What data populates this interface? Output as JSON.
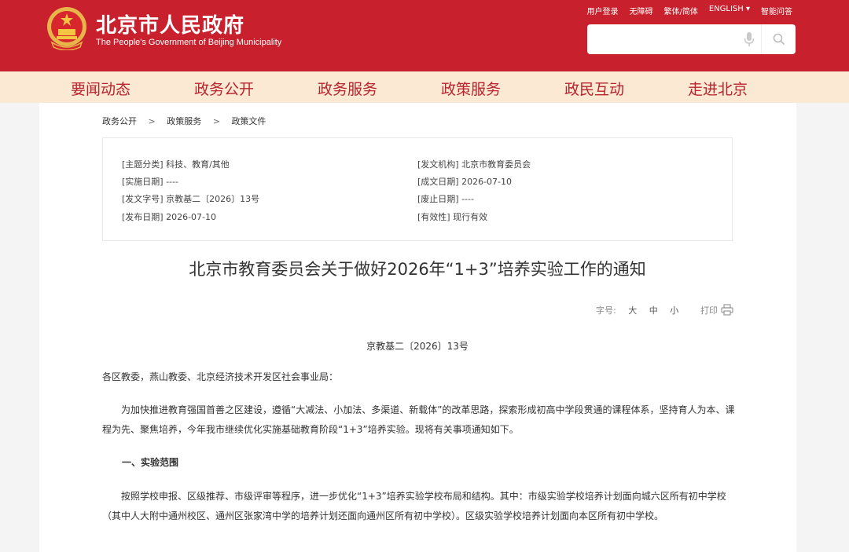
{
  "header": {
    "site_name": "北京市人民政府",
    "site_subtitle": "The People's Government of Beijing Municipality",
    "top_links": [
      "用户登录",
      "无障碍",
      "繁体/简体",
      "ENGLISH ▾",
      "智能问答"
    ],
    "search_placeholder": "",
    "brand_color": "#c8202c"
  },
  "nav": {
    "items": [
      "要闻动态",
      "政务公开",
      "政务服务",
      "政策服务",
      "政民互动",
      "走进北京"
    ],
    "bg_color": "#fbe9d4",
    "text_color": "#b8232d"
  },
  "breadcrumb": [
    "政务公开",
    "政策服务",
    "政策文件"
  ],
  "info": {
    "left": [
      "[主题分类] 科技、教育/其他",
      "[实施日期] ----",
      "[发文字号] 京教基二〔2026〕13号",
      "[发布日期] 2026-07-10"
    ],
    "right": [
      "[发文机构] 北京市教育委员会",
      "[成文日期] 2026-07-10",
      "[废止日期] ----",
      "[有效性] 现行有效"
    ]
  },
  "doc": {
    "title": "北京市教育委员会关于做好2026年“1+3”培养实验工作的通知",
    "font_label": "字号:",
    "font_large": "大",
    "font_medium": "中",
    "font_small": "小",
    "print_label": "打印",
    "doc_number": "京教基二〔2026〕13号",
    "salutation": "各区教委，燕山教委、北京经济技术开发区社会事业局：",
    "paragraph1": "　　为加快推进教育强国首善之区建设，遵循“大减法、小加法、多渠道、新载体”的改革思路，探索形成初高中学段贯通的课程体系，坚持育人为本、课程为先、聚焦培养，今年我市继续优化实施基础教育阶段“1+3”培养实验。现将有关事项通知如下。",
    "section1": "一、实验范围",
    "paragraph2": "　　按照学校申报、区级推荐、市级评审等程序，进一步优化“1+3”培养实验学校布局和结构。其中：市级实验学校培养计划面向城六区所有初中学校（其中人大附中通州校区、通州区张家湾中学的培养计划还面向通州区所有初中学校）。区级实验学校培养计划面向本区所有初中学校。"
  }
}
